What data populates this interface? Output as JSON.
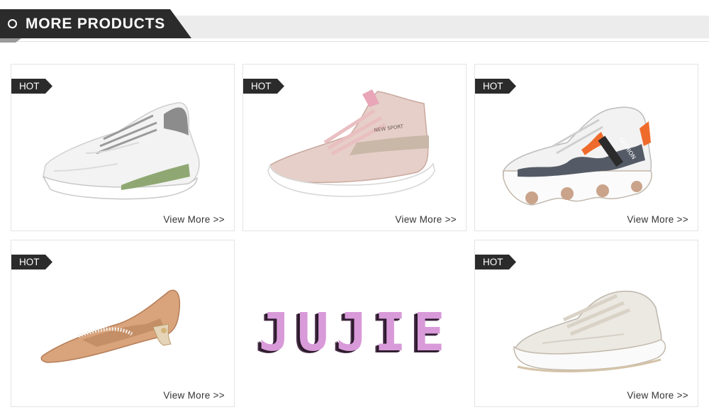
{
  "section": {
    "title": "MORE PRODUCTS",
    "icon": "circle-bullet-icon"
  },
  "badge_label": "HOT",
  "products": [
    {
      "name": "white-mesh-sneaker",
      "badge": "HOT",
      "link": "View More >>"
    },
    {
      "name": "pink-knit-sneaker",
      "badge": "HOT",
      "link": "View More >>"
    },
    {
      "name": "fashion-chunky-sneaker",
      "badge": "HOT",
      "link": "View More >>"
    },
    {
      "name": "tan-pointed-flat",
      "badge": "HOT",
      "link": "View More >>"
    },
    {
      "name": "cream-platform-sneaker",
      "badge": "HOT",
      "link": "View More >>"
    }
  ],
  "brand_logo": {
    "text": "JUJIE",
    "color": "#d99ad9"
  },
  "shoe_fashion_tag": "FASHION",
  "shoe_text_brand": "NEW SPORT",
  "colors": {
    "dark": "#2b2b2b",
    "header_bg": "#ececec",
    "border": "#e4e4e4"
  }
}
